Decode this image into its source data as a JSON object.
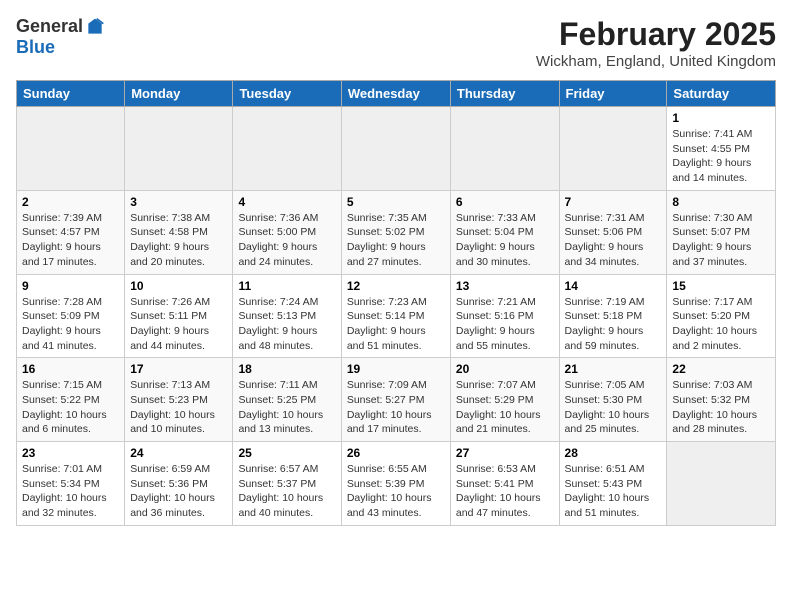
{
  "app": {
    "logo_general": "General",
    "logo_blue": "Blue"
  },
  "header": {
    "title": "February 2025",
    "location": "Wickham, England, United Kingdom"
  },
  "weekdays": [
    "Sunday",
    "Monday",
    "Tuesday",
    "Wednesday",
    "Thursday",
    "Friday",
    "Saturday"
  ],
  "weeks": [
    [
      {
        "day": "",
        "empty": true
      },
      {
        "day": "",
        "empty": true
      },
      {
        "day": "",
        "empty": true
      },
      {
        "day": "",
        "empty": true
      },
      {
        "day": "",
        "empty": true
      },
      {
        "day": "",
        "empty": true
      },
      {
        "day": "1",
        "sunrise": "7:41 AM",
        "sunset": "4:55 PM",
        "daylight": "9 hours and 14 minutes."
      }
    ],
    [
      {
        "day": "2",
        "sunrise": "7:39 AM",
        "sunset": "4:57 PM",
        "daylight": "9 hours and 17 minutes."
      },
      {
        "day": "3",
        "sunrise": "7:38 AM",
        "sunset": "4:58 PM",
        "daylight": "9 hours and 20 minutes."
      },
      {
        "day": "4",
        "sunrise": "7:36 AM",
        "sunset": "5:00 PM",
        "daylight": "9 hours and 24 minutes."
      },
      {
        "day": "5",
        "sunrise": "7:35 AM",
        "sunset": "5:02 PM",
        "daylight": "9 hours and 27 minutes."
      },
      {
        "day": "6",
        "sunrise": "7:33 AM",
        "sunset": "5:04 PM",
        "daylight": "9 hours and 30 minutes."
      },
      {
        "day": "7",
        "sunrise": "7:31 AM",
        "sunset": "5:06 PM",
        "daylight": "9 hours and 34 minutes."
      },
      {
        "day": "8",
        "sunrise": "7:30 AM",
        "sunset": "5:07 PM",
        "daylight": "9 hours and 37 minutes."
      }
    ],
    [
      {
        "day": "9",
        "sunrise": "7:28 AM",
        "sunset": "5:09 PM",
        "daylight": "9 hours and 41 minutes."
      },
      {
        "day": "10",
        "sunrise": "7:26 AM",
        "sunset": "5:11 PM",
        "daylight": "9 hours and 44 minutes."
      },
      {
        "day": "11",
        "sunrise": "7:24 AM",
        "sunset": "5:13 PM",
        "daylight": "9 hours and 48 minutes."
      },
      {
        "day": "12",
        "sunrise": "7:23 AM",
        "sunset": "5:14 PM",
        "daylight": "9 hours and 51 minutes."
      },
      {
        "day": "13",
        "sunrise": "7:21 AM",
        "sunset": "5:16 PM",
        "daylight": "9 hours and 55 minutes."
      },
      {
        "day": "14",
        "sunrise": "7:19 AM",
        "sunset": "5:18 PM",
        "daylight": "9 hours and 59 minutes."
      },
      {
        "day": "15",
        "sunrise": "7:17 AM",
        "sunset": "5:20 PM",
        "daylight": "10 hours and 2 minutes."
      }
    ],
    [
      {
        "day": "16",
        "sunrise": "7:15 AM",
        "sunset": "5:22 PM",
        "daylight": "10 hours and 6 minutes."
      },
      {
        "day": "17",
        "sunrise": "7:13 AM",
        "sunset": "5:23 PM",
        "daylight": "10 hours and 10 minutes."
      },
      {
        "day": "18",
        "sunrise": "7:11 AM",
        "sunset": "5:25 PM",
        "daylight": "10 hours and 13 minutes."
      },
      {
        "day": "19",
        "sunrise": "7:09 AM",
        "sunset": "5:27 PM",
        "daylight": "10 hours and 17 minutes."
      },
      {
        "day": "20",
        "sunrise": "7:07 AM",
        "sunset": "5:29 PM",
        "daylight": "10 hours and 21 minutes."
      },
      {
        "day": "21",
        "sunrise": "7:05 AM",
        "sunset": "5:30 PM",
        "daylight": "10 hours and 25 minutes."
      },
      {
        "day": "22",
        "sunrise": "7:03 AM",
        "sunset": "5:32 PM",
        "daylight": "10 hours and 28 minutes."
      }
    ],
    [
      {
        "day": "23",
        "sunrise": "7:01 AM",
        "sunset": "5:34 PM",
        "daylight": "10 hours and 32 minutes."
      },
      {
        "day": "24",
        "sunrise": "6:59 AM",
        "sunset": "5:36 PM",
        "daylight": "10 hours and 36 minutes."
      },
      {
        "day": "25",
        "sunrise": "6:57 AM",
        "sunset": "5:37 PM",
        "daylight": "10 hours and 40 minutes."
      },
      {
        "day": "26",
        "sunrise": "6:55 AM",
        "sunset": "5:39 PM",
        "daylight": "10 hours and 43 minutes."
      },
      {
        "day": "27",
        "sunrise": "6:53 AM",
        "sunset": "5:41 PM",
        "daylight": "10 hours and 47 minutes."
      },
      {
        "day": "28",
        "sunrise": "6:51 AM",
        "sunset": "5:43 PM",
        "daylight": "10 hours and 51 minutes."
      },
      {
        "day": "",
        "empty": true
      }
    ]
  ]
}
